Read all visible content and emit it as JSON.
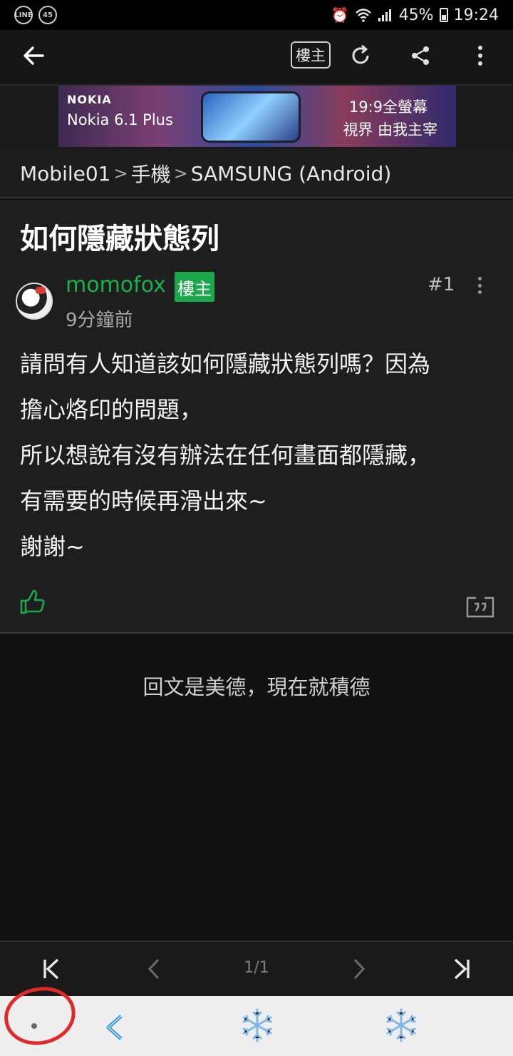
{
  "status_bar": {
    "left_icons": [
      "LINE",
      "45"
    ],
    "battery": "45%",
    "time": "19:24"
  },
  "app_bar": {
    "op_badge": "樓主"
  },
  "ad": {
    "brand": "NOKIA",
    "model": "Nokia 6.1 Plus",
    "tagline_1": "19:9全螢幕",
    "tagline_2": "視界 由我主宰"
  },
  "breadcrumb": {
    "items": [
      "Mobile01",
      "手機",
      "SAMSUNG (Android)"
    ],
    "separator": ">"
  },
  "post": {
    "title": "如何隱藏狀態列",
    "author": "momofox",
    "op_tag": "樓主",
    "time": "9分鐘前",
    "floor": "#1",
    "body": [
      "請問有人知道該如何隱藏狀態列嗎？因為",
      "擔心烙印的問題，",
      "所以想說有沒有辦法在任何畫面都隱藏，",
      "有需要的時候再滑出來~",
      "謝謝~"
    ]
  },
  "reply_prompt": "回文是美德，現在就積德",
  "pager": {
    "label": "1/1"
  },
  "colors": {
    "accent_green": "#1aa84a",
    "annotation_red": "#e02a2a"
  }
}
